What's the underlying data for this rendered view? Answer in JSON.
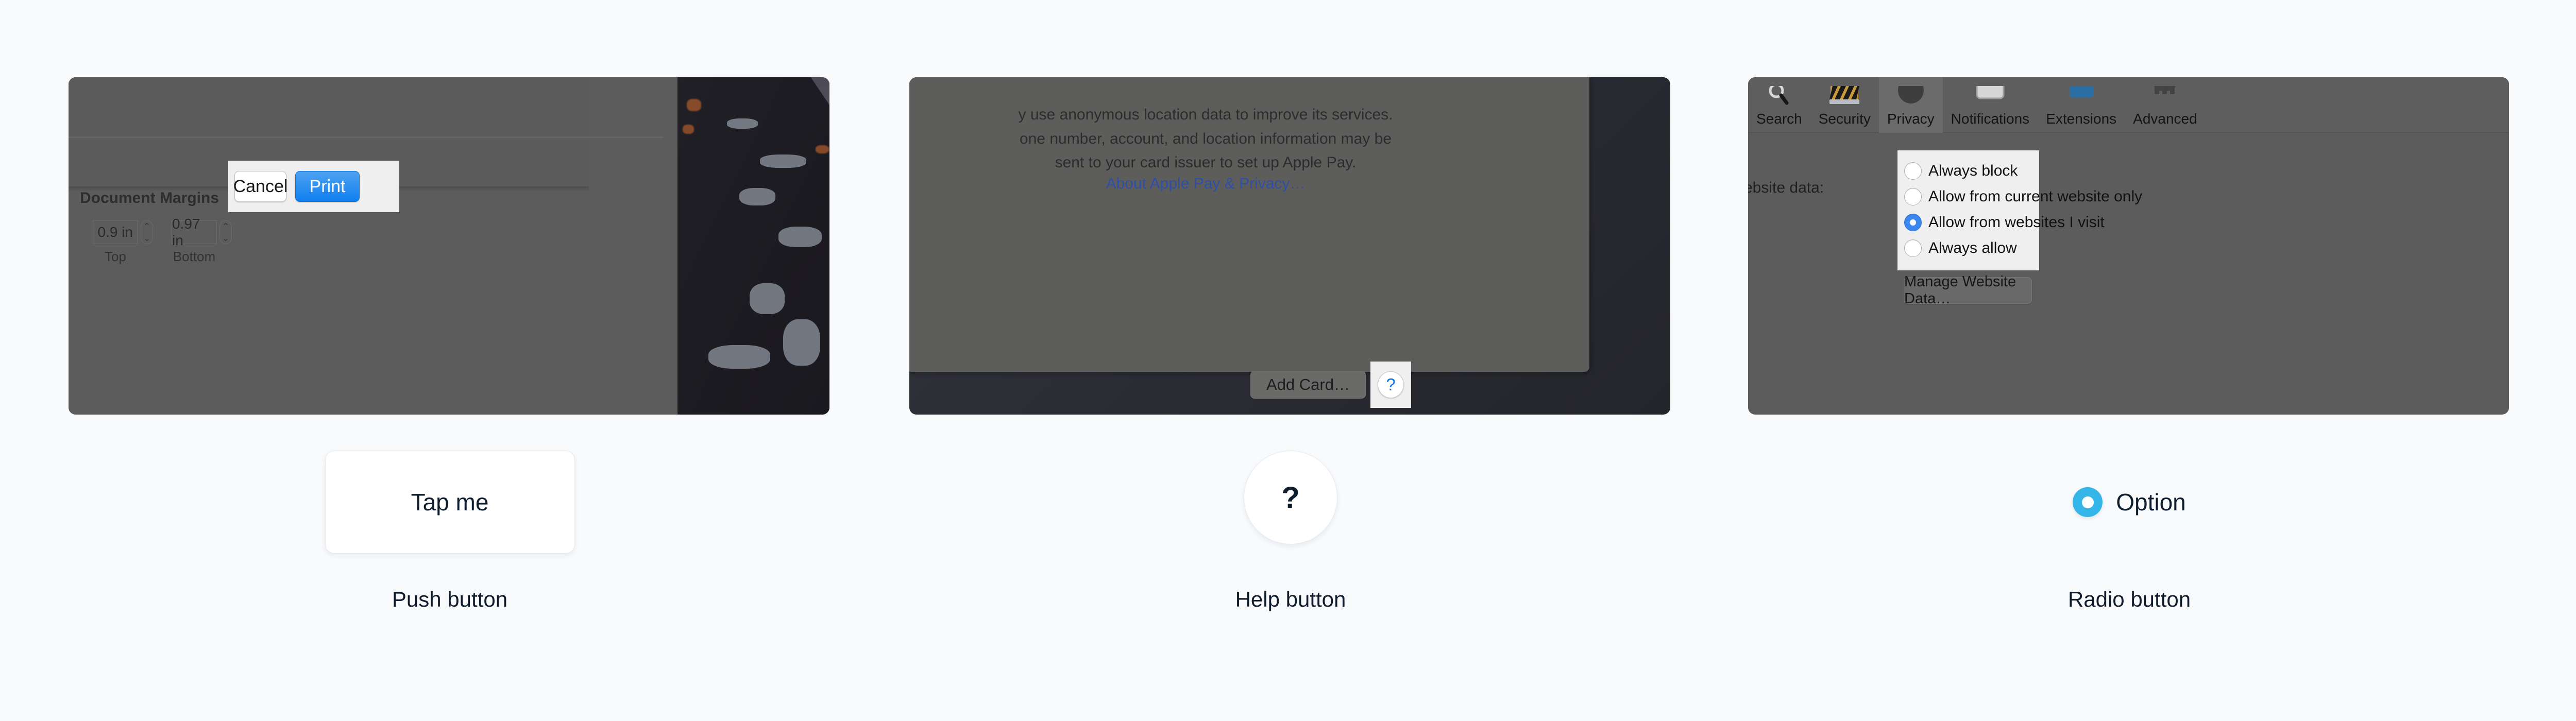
{
  "background_color": "#f8fafc",
  "columns": [
    {
      "id": "push-button",
      "screenshot": {
        "app": "Print dialog",
        "buttons": {
          "cancel": "Cancel",
          "print": "Print"
        },
        "section_title": "Document Margins",
        "steppers": [
          {
            "value": "0.9 in",
            "caption": "Top",
            "up_glyph": "⌃",
            "down_glyph": "⌄"
          },
          {
            "value": "0.97 in",
            "caption": "Bottom",
            "up_glyph": "⌃",
            "down_glyph": "⌄"
          }
        ]
      },
      "example": {
        "label": "Tap me"
      },
      "caption": "Push button"
    },
    {
      "id": "help-button",
      "screenshot": {
        "app": "Apple Pay setup sheet",
        "body_text": "y use anonymous location data to improve its services.\none number, account, and location information may be\nsent to your card issuer to set up Apple Pay.",
        "link_text": "About Apple Pay & Privacy…",
        "buttons": {
          "add_card": "Add Card…",
          "help": "?"
        },
        "help_button_color": "#0a74e8"
      },
      "example": {
        "label": "?"
      },
      "caption": "Help button"
    },
    {
      "id": "radio-button",
      "screenshot": {
        "app": "Safari Preferences — Privacy",
        "tabs": [
          {
            "label": "Search",
            "icon": "magnifier-icon",
            "active": false
          },
          {
            "label": "Security",
            "icon": "shield-stripes-icon",
            "active": false
          },
          {
            "label": "Privacy",
            "icon": "hand-icon",
            "active": true
          },
          {
            "label": "Notifications",
            "icon": "bell-window-icon",
            "active": false
          },
          {
            "label": "Extensions",
            "icon": "puzzle-icon",
            "active": false
          },
          {
            "label": "Advanced",
            "icon": "gear-icon",
            "active": false
          }
        ],
        "field_label": "ebsite data:",
        "radio_options": [
          {
            "label": "Always block",
            "selected": false
          },
          {
            "label": "Allow from current website only",
            "selected": false
          },
          {
            "label": "Allow from websites I visit",
            "selected": true
          },
          {
            "label": "Always allow",
            "selected": false
          }
        ],
        "buttons": {
          "manage": "Manage Website Data…"
        },
        "selected_radio_color": "#3b86ef"
      },
      "example": {
        "label": "Option",
        "accent_color": "#35b6e8"
      },
      "caption": "Radio button"
    }
  ]
}
